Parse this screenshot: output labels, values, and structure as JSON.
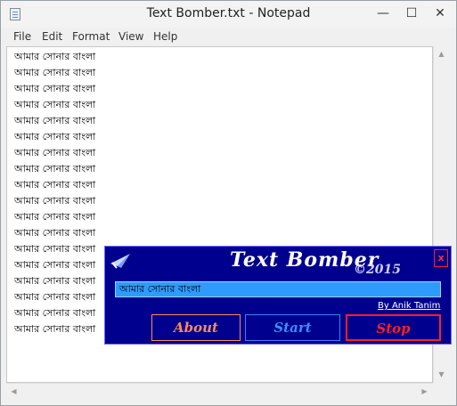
{
  "notepad": {
    "title": "Text Bomber.txt - Notepad",
    "controls": {
      "minimize": "—",
      "maximize": "☐",
      "close": "✕"
    },
    "menu": [
      "File",
      "Edit",
      "Format",
      "View",
      "Help"
    ],
    "lines": [
      "আমার সোনার বাংলা",
      "আমার সোনার বাংলা",
      "আমার সোনার বাংলা",
      "আমার সোনার বাংলা",
      "আমার সোনার বাংলা",
      "আমার সোনার বাংলা",
      "আমার সোনার বাংলা",
      "আমার সোনার বাংলা",
      "আমার সোনার বাংলা",
      "আমার সোনার বাংলা",
      "আমার সোনার বাংলা",
      "আমার সোনার বাংলা",
      "আমার সোনার বাংলা",
      "আমার সোনার বাংলা",
      "আমার সোনার বাংলা",
      "আমার সোনার বাংলা",
      "আমার সোনার বাংলা",
      "আমার সোনার বাংলা"
    ],
    "scroll": {
      "up": "▲",
      "down": "▼",
      "left": "◀",
      "right": "▶"
    }
  },
  "bomber": {
    "title": "Text Bomber",
    "copyright": "©2015",
    "close_label": "x",
    "message": "আমার সোনার বাংলা",
    "credit": "By Anik Tanim",
    "buttons": {
      "about": "About",
      "start": "Start",
      "stop": "Stop"
    },
    "colors": {
      "background": "#00008e",
      "input": "#2e9bff",
      "about": "#ff8a5a",
      "start": "#3a8fff",
      "stop": "#ff2020"
    }
  }
}
